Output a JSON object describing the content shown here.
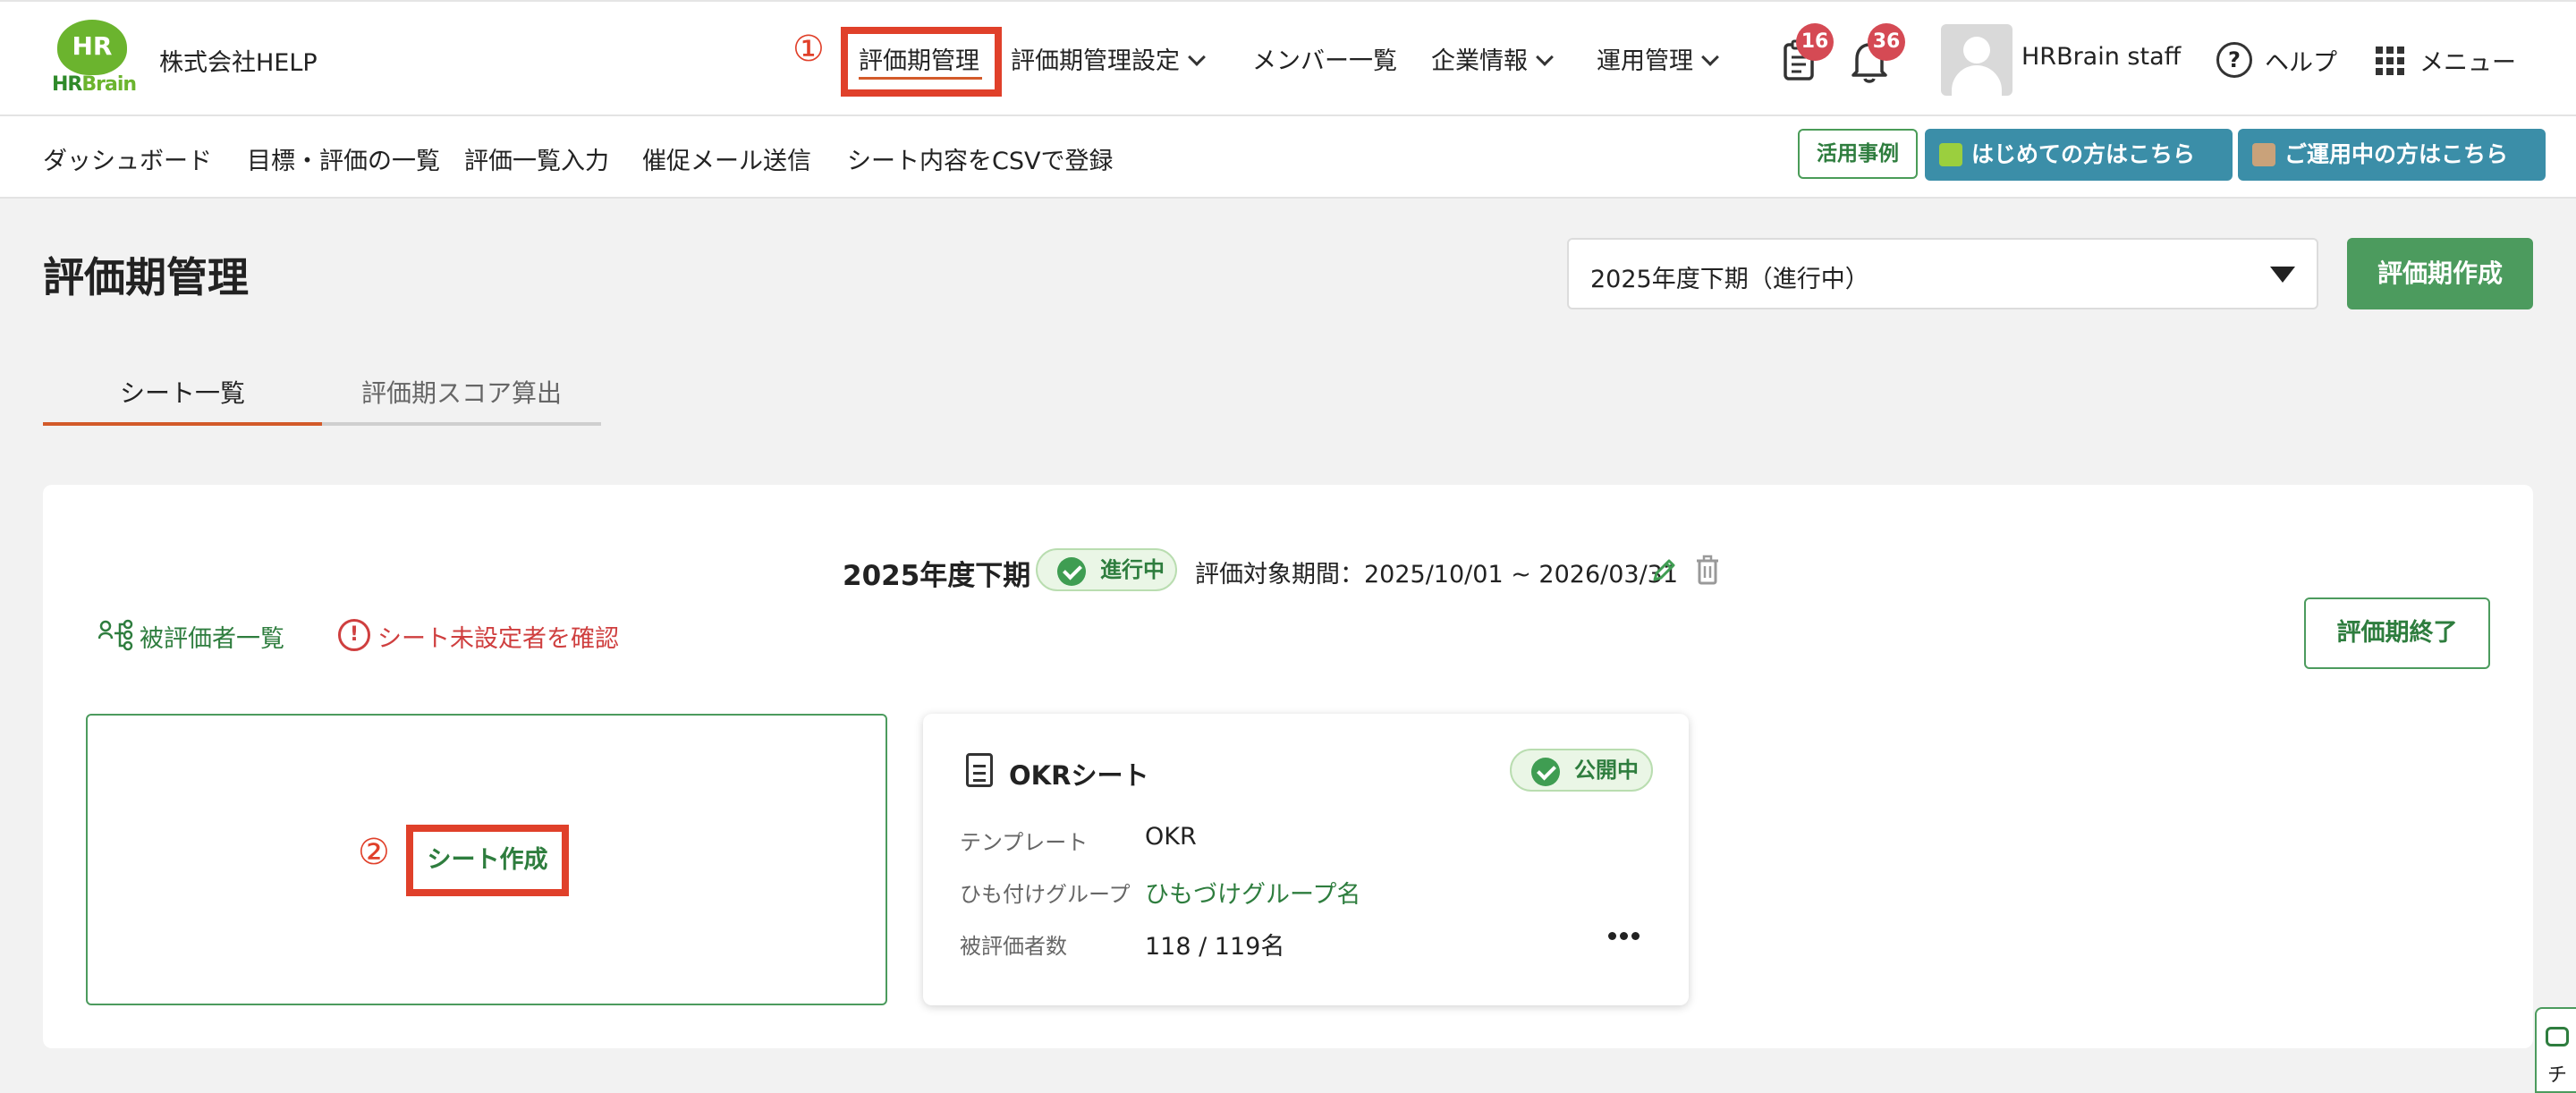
{
  "header": {
    "logo_mark": "HR",
    "logo_text_hr": "HR",
    "logo_text_brain": "Brain",
    "company": "株式会社HELP",
    "nav": [
      {
        "label": "評価期管理"
      },
      {
        "label": "評価期管理設定"
      },
      {
        "label": "メンバー一覧"
      },
      {
        "label": "企業情報"
      },
      {
        "label": "運用管理"
      }
    ],
    "tasks_badge": "16",
    "notifications_badge": "36",
    "user_name": "HRBrain staff",
    "help_label": "ヘルプ",
    "help_glyph": "?",
    "menu_label": "メニュー"
  },
  "annotations": {
    "step1": "①",
    "step2": "②"
  },
  "subnav": {
    "items": [
      "ダッシュボード",
      "目標・評価の一覧",
      "評価一覧入力",
      "催促メール送信",
      "シート内容をCSVで登録"
    ],
    "case_studies": "活用事例",
    "first_time": "はじめての方はこちら",
    "in_use": "ご運用中の方はこちら"
  },
  "page": {
    "title": "評価期管理",
    "period_selected": "2025年度下期（進行中）",
    "create_period": "評価期作成",
    "tabs": [
      {
        "label": "シート一覧",
        "active": true
      },
      {
        "label": "評価期スコア算出",
        "active": false
      }
    ]
  },
  "period": {
    "name": "2025年度下期",
    "status": "進行中",
    "range": "評価対象期間：2025/10/01 ~ 2026/03/31",
    "evaluatees_link": "被評価者一覧",
    "unset_link": "シート未設定者を確認",
    "end_button": "評価期終了"
  },
  "create_sheet": {
    "label": "シート作成"
  },
  "sheet": {
    "title": "OKRシート",
    "status": "公開中",
    "template_label": "テンプレート",
    "template_value": "OKR",
    "group_label": "ひも付けグループ",
    "group_value": "ひもづけグループ名",
    "evaluatees_label": "被評価者数",
    "evaluatees_value": "118 / 119名"
  },
  "chat": {
    "label": "チ"
  },
  "colors": {
    "brand_green": "#4c9b5e",
    "accent_orange": "#d35a2a",
    "annotation_red": "#e0402a",
    "teal_button": "#3b8ea8",
    "badge_red": "#d54a54",
    "danger_text": "#cf3f3f"
  }
}
